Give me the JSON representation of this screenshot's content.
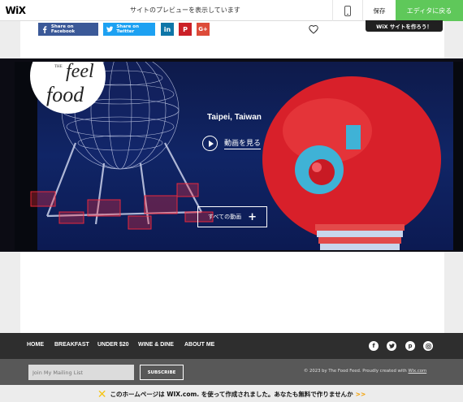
{
  "topbar": {
    "logo": "WiX",
    "preview_text": "サイトのプレビューを表示しています",
    "save_label": "保存",
    "editor_label": "エディタに戻る",
    "wix_badge": "WiX サイトを作ろう！"
  },
  "share": {
    "facebook": "Share on Facebook",
    "twitter": "Share on Twitter",
    "linkedin": "in",
    "pinterest": "P",
    "googleplus": "G+"
  },
  "hero": {
    "logo_the": "THE",
    "logo_feel": "feel",
    "logo_food": "food",
    "location": "Taipei, Taiwan",
    "watch_label": "動画を見る",
    "all_videos_label": "すべての動画"
  },
  "footer": {
    "nav": [
      "HOME",
      "BREAKFAST",
      "UNDER $20",
      "WINE & DINE",
      "ABOUT ME"
    ],
    "social": [
      "facebook-icon",
      "twitter-icon",
      "pinterest-icon",
      "instagram-icon"
    ],
    "mailing_placeholder": "Join My Mailing List",
    "subscribe_label": "SUBSCRIBE",
    "copyright_text": "© 2023 by The Food Feed. Proudly created with ",
    "copyright_link": "Wix.com"
  },
  "wix_banner": {
    "text": "このホームページは WIX.com. を使って作成されました。あなたも無料で作りませんか",
    "arrow": ">>"
  },
  "colors": {
    "facebook": "#3b5998",
    "twitter": "#1da1f2",
    "linkedin": "#0e76a8",
    "pinterest": "#cb2027",
    "googleplus": "#dd4b39",
    "editor_green": "#5fc85a",
    "footer_dark": "#2e2e2e",
    "footer_mid": "#585858"
  }
}
